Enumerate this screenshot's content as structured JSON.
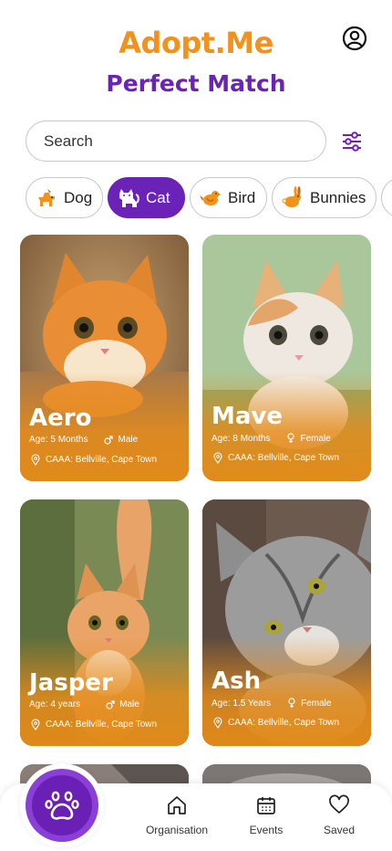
{
  "header": {
    "logo": "Adopt.Me",
    "subtitle": "Perfect Match"
  },
  "search": {
    "placeholder": "Search",
    "value": ""
  },
  "categories": [
    {
      "label": "Dog",
      "icon": "dog-icon",
      "active": false
    },
    {
      "label": "Cat",
      "icon": "cat-icon",
      "active": true
    },
    {
      "label": "Bird",
      "icon": "bird-icon",
      "active": false
    },
    {
      "label": "Bunnies",
      "icon": "bunny-icon",
      "active": false
    }
  ],
  "pets": [
    {
      "name": "Aero",
      "age": "Age: 5 Months",
      "gender": "Male",
      "location": "CAAA: Bellville, Cape Town"
    },
    {
      "name": "Mave",
      "age": "Age: 8 Months",
      "gender": "Female",
      "location": "CAAA: Bellville, Cape Town"
    },
    {
      "name": "Jasper",
      "age": "Age: 4 years",
      "gender": "Male",
      "location": "CAAA: Bellville, Cape Town"
    },
    {
      "name": "Ash",
      "age": "Age: 1.5 Years",
      "gender": "Female",
      "location": "CAAA: Bellville, Cape Town"
    }
  ],
  "nav": {
    "home_icon": "paw-icon",
    "items": [
      {
        "label": "Organisation",
        "icon": "house-icon"
      },
      {
        "label": "Events",
        "icon": "calendar-icon"
      },
      {
        "label": "Saved",
        "icon": "heart-icon"
      }
    ]
  },
  "colors": {
    "brand_orange": "#f0921c",
    "brand_purple": "#6a23b6"
  }
}
